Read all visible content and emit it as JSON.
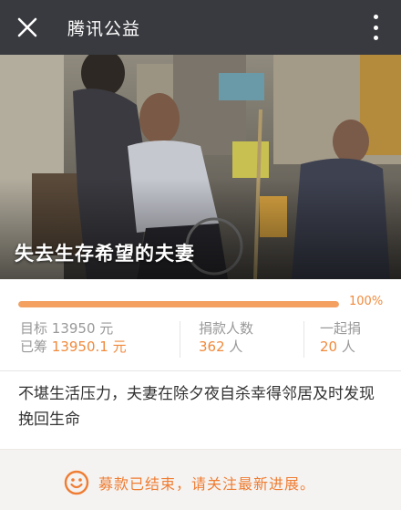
{
  "header": {
    "title": "腾讯公益",
    "close_icon": "close-icon",
    "more_icon": "more-vertical-icon",
    "background": "#393a3f"
  },
  "hero": {
    "title": "失去生存希望的夫妻"
  },
  "progress": {
    "fraction": 1.0,
    "percent_label": "100%",
    "color": "#f3a060"
  },
  "stats": {
    "target_label": "目标",
    "target_value": "13950 元",
    "raised_label": "已筹",
    "raised_value": "13950.1 元",
    "donors_label": "捐款人数",
    "donors_value": "362",
    "donors_unit": "人",
    "together_label": "一起捐",
    "together_value": "20",
    "together_unit": "人",
    "accent": "#f08a3c"
  },
  "description": "不堪生活压力，夫妻在除夕夜自杀幸得邻居及时发现挽回生命",
  "footer": {
    "icon": "smile-icon",
    "text": "募款已结束，请关注最新进展。",
    "color": "#ef7d33"
  }
}
